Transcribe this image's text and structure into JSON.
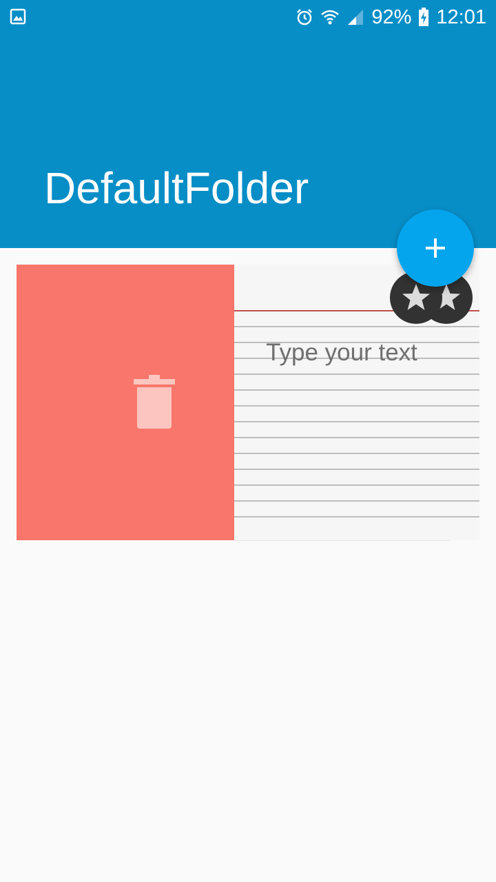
{
  "status_bar": {
    "battery": "92%",
    "time": "12:01",
    "icons": [
      "gallery-icon",
      "alarm-icon",
      "wifi-icon",
      "signal-icon",
      "battery-charging-icon"
    ]
  },
  "app_bar": {
    "title": "DefaultFolder",
    "color": "#088ec7"
  },
  "fab": {
    "icon": "plus-icon",
    "color": "#05a5ee"
  },
  "note": {
    "placeholder": "Type your text",
    "swipe_action_icon": "trash-icon",
    "swipe_action_color": "#f8766b",
    "favorite_icon": "star-icon"
  }
}
